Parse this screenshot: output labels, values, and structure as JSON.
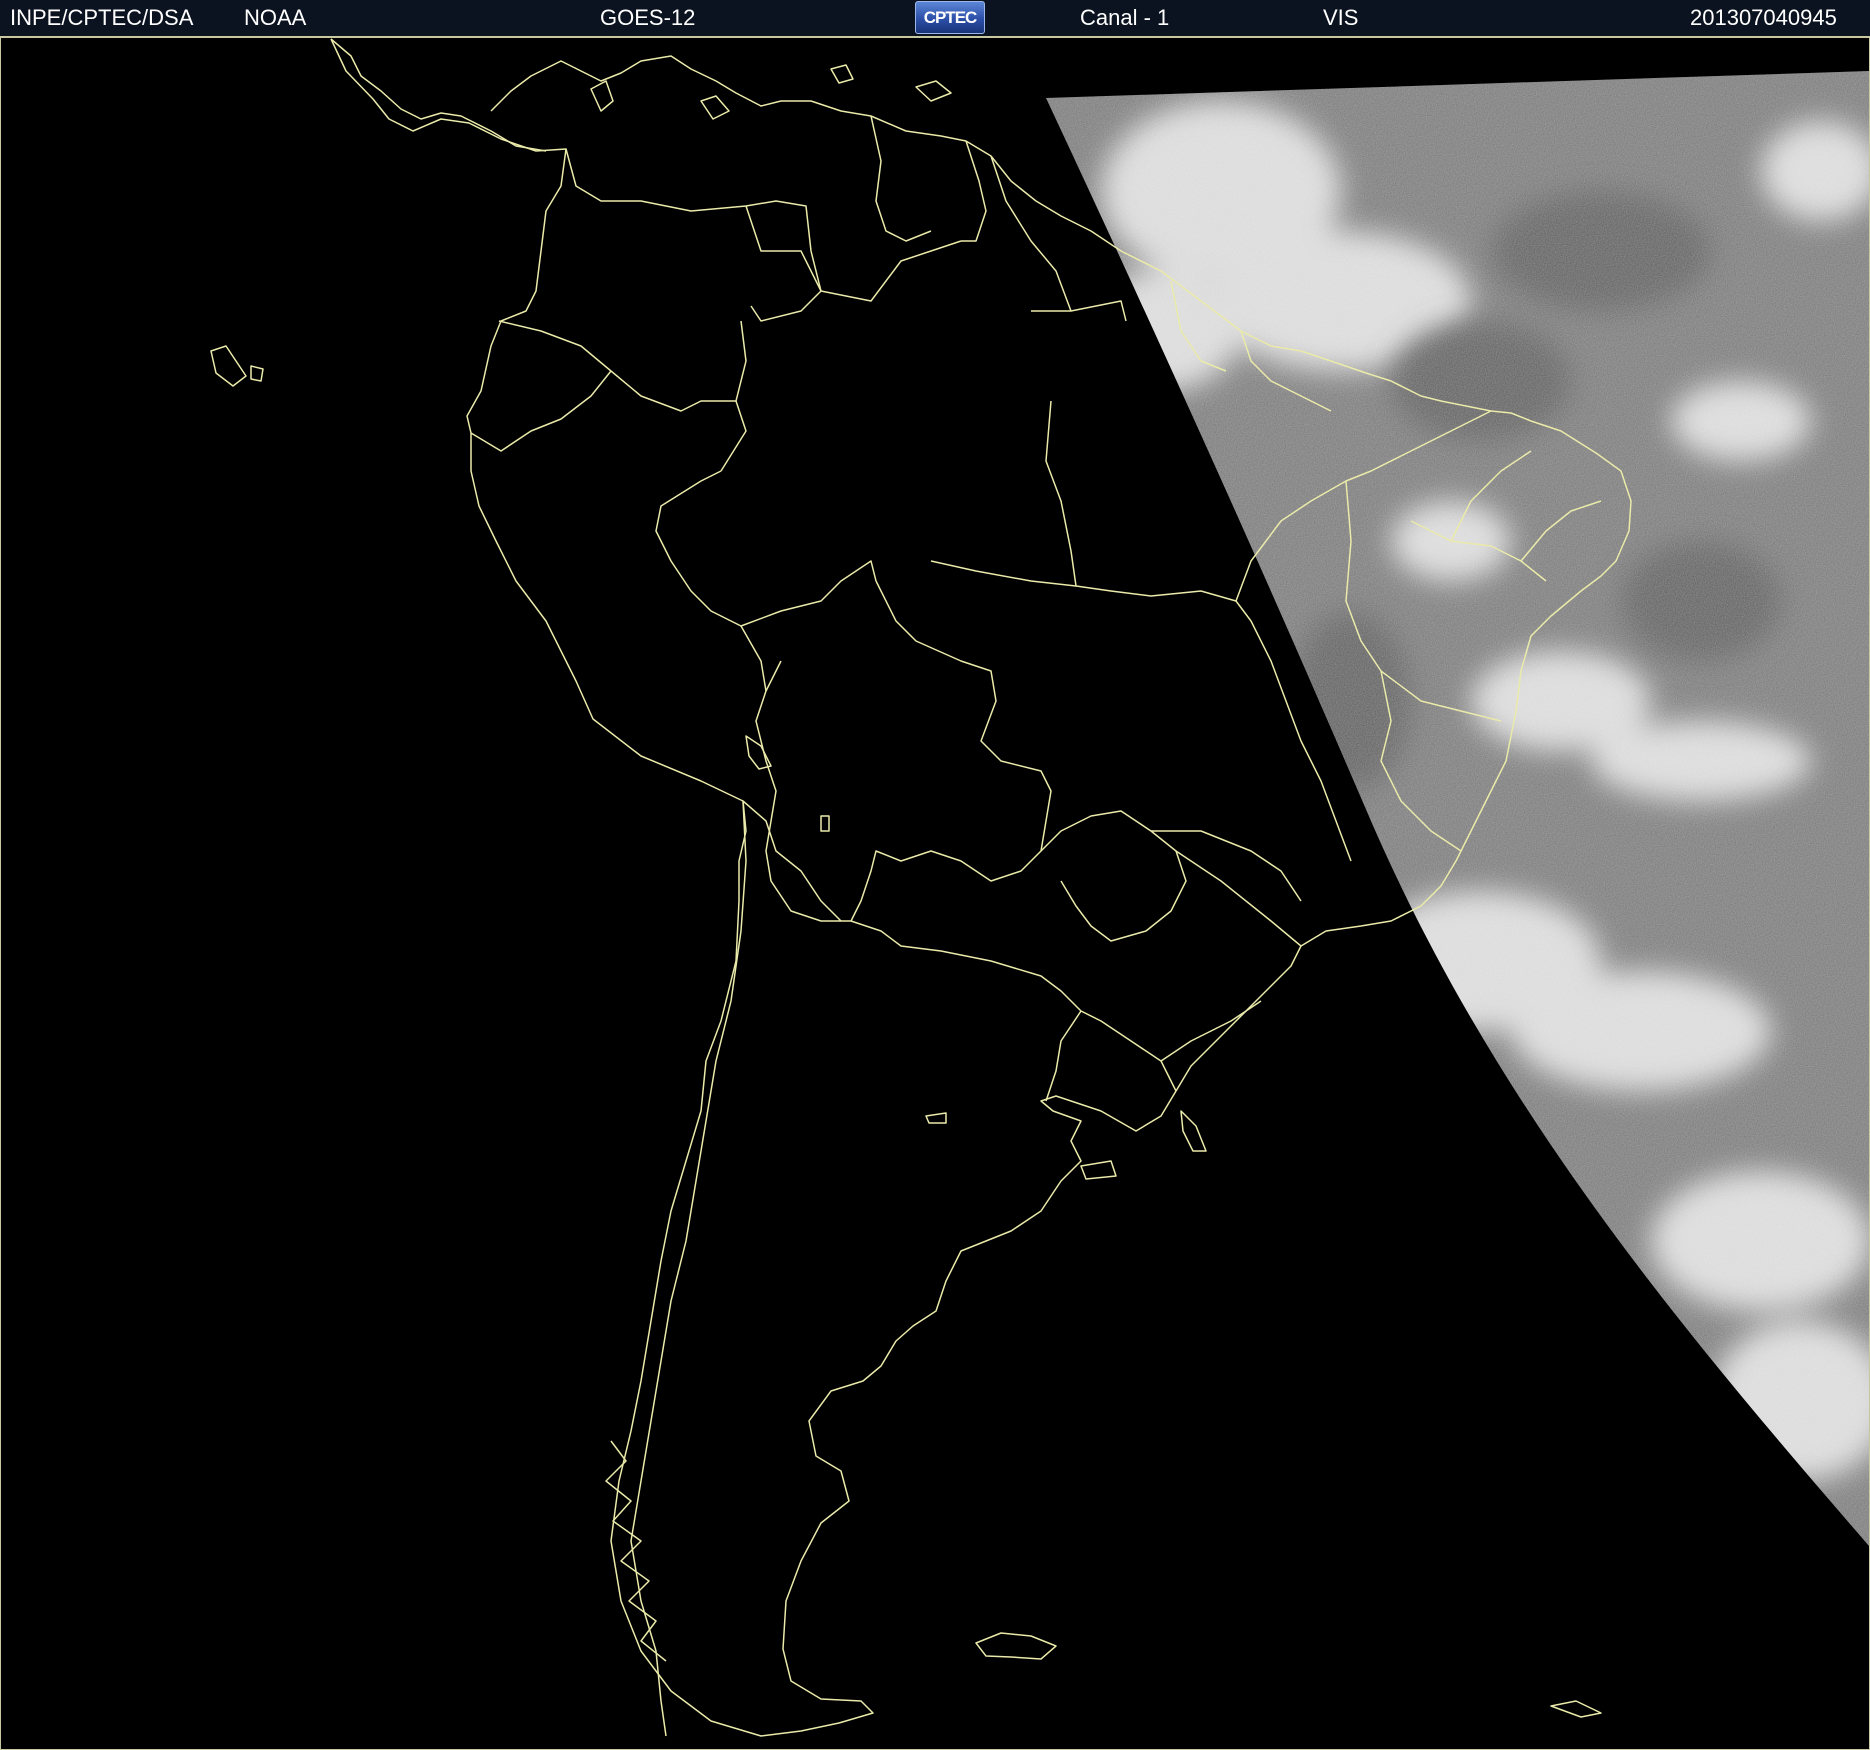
{
  "header": {
    "org": "INPE/CPTEC/DSA",
    "agency": "NOAA",
    "satellite": "GOES-12",
    "logo_text": "CPTEC",
    "channel": "Canal - 1",
    "band": "VIS",
    "timestamp": "201307040945"
  },
  "image": {
    "region": "South America",
    "imagery_color": "#7a7a7a",
    "cloud_color": "#e6e6e6",
    "border_color": "#eaeaaa",
    "background_color": "#000000"
  }
}
